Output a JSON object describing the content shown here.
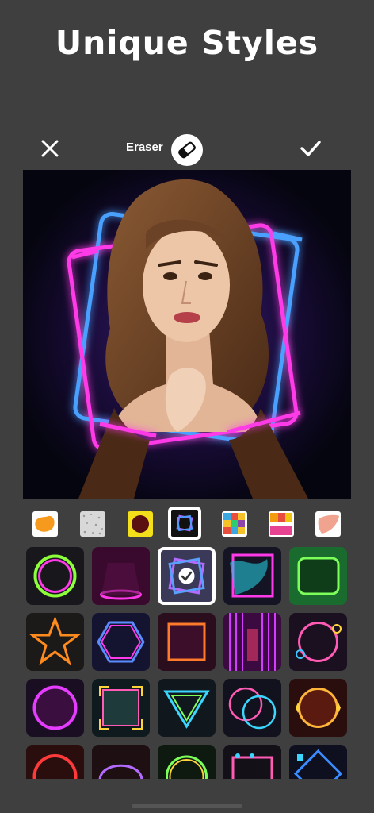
{
  "headline": "Unique Styles",
  "toolbar": {
    "close_icon": "close-icon",
    "tool_label": "Eraser",
    "tool_icon": "eraser-icon",
    "confirm_icon": "checkmark-icon"
  },
  "canvas": {
    "image": "portrait-with-neon-frame"
  },
  "colors": {
    "background": "#3f3f3f",
    "neon_pink": "#ff3cf0",
    "neon_blue": "#3c8cff",
    "selection": "#ffffff"
  },
  "category_strip": {
    "selected_index": 3,
    "items": [
      "paint-splash",
      "texture",
      "yellow-frame",
      "neon-frame",
      "mosaic",
      "color-blocks",
      "brush-stroke"
    ]
  },
  "style_grid": {
    "selected_index": 2,
    "items": [
      "neon-circle-green-pink",
      "neon-stage-pink",
      "neon-double-square",
      "neon-splash-frame",
      "neon-leaf-frame",
      "neon-star-orange",
      "neon-hexagon",
      "neon-square-orange",
      "neon-curtains",
      "neon-emoji-circle",
      "neon-circle-pink",
      "neon-square-corners",
      "neon-triangle",
      "neon-double-circle",
      "neon-star-circle",
      "neon-circle-red",
      "neon-arch",
      "neon-circle-yellow",
      "neon-rect-drops",
      "neon-diamond"
    ]
  }
}
